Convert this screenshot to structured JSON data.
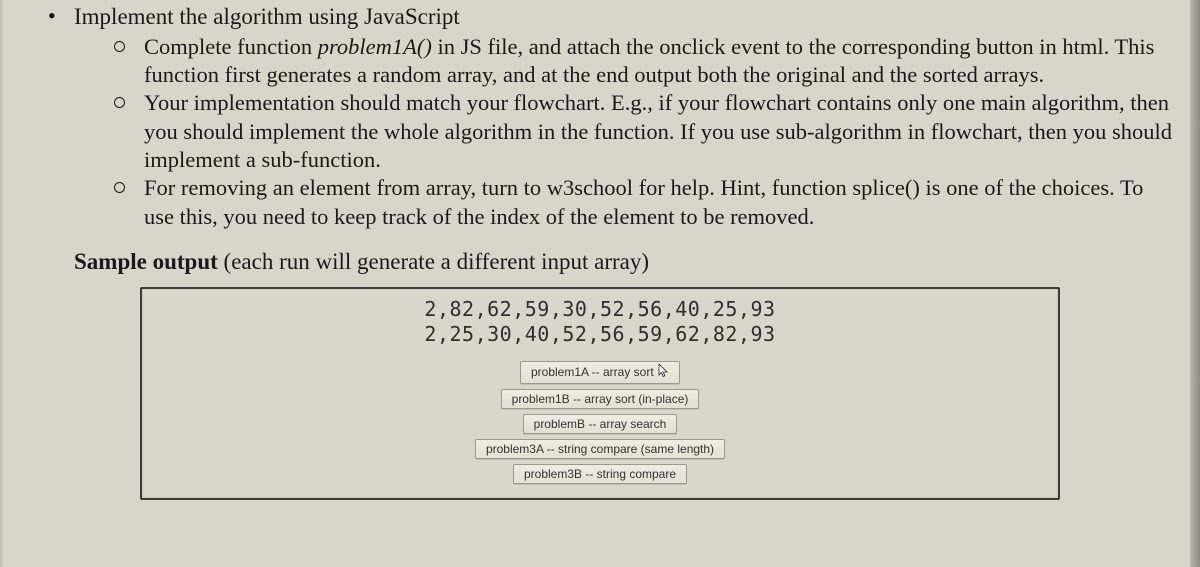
{
  "list": {
    "main_item": "Implement the algorithm using JavaScript",
    "sub_items": [
      {
        "prefix": "Complete function ",
        "func": "problem1A()",
        "rest": " in JS file, and attach the onclick event to the corresponding button in html.  This function first generates a random array, and at the end output both the original and the sorted arrays."
      },
      {
        "text": "Your implementation should match your flowchart. E.g., if your flowchart contains only one main algorithm, then you should implement the whole algorithm in the function. If you use sub-algorithm in flowchart, then you should implement a sub-function."
      },
      {
        "text": "For removing an element from array, turn to w3school for help. Hint, function splice() is one of the choices. To use this, you need to keep track of the index of the element to be removed."
      }
    ]
  },
  "sample": {
    "label_bold": "Sample output",
    "label_rest": "  (each run will generate a different input array)",
    "line1": "2,82,62,59,30,52,56,40,25,93",
    "line2": "2,25,30,40,52,56,59,62,82,93",
    "buttons": [
      "problem1A -- array sort",
      "problem1B -- array sort (in-place)",
      "problemB -- array search",
      "problem3A -- string compare (same length)",
      "problem3B -- string compare"
    ]
  }
}
